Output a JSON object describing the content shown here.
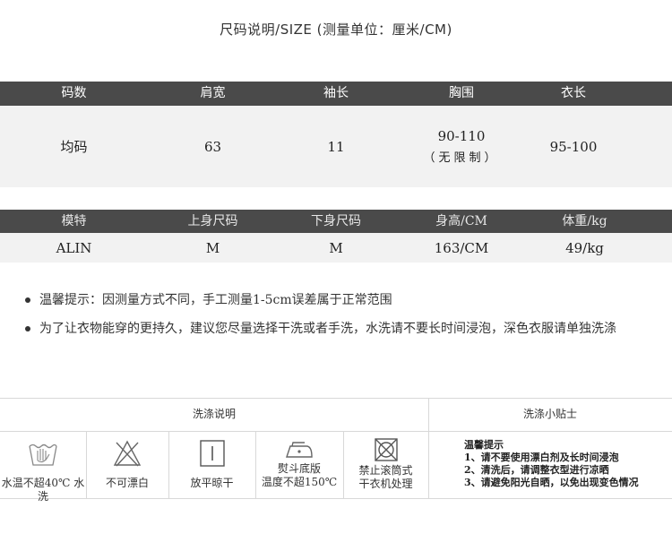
{
  "title": "尺码说明/SIZE (测量单位：厘米/CM)",
  "size_table": {
    "headers": [
      "码数",
      "肩宽",
      "袖长",
      "胸围",
      "衣长"
    ],
    "row": {
      "size": "均码",
      "shoulder": "63",
      "sleeve": "11",
      "chest": "90-110",
      "chest_note": "（无限制）",
      "length": "95-100"
    }
  },
  "model_table": {
    "headers": [
      "模特",
      "上身尺码",
      "下身尺码",
      "身高/CM",
      "体重/kg"
    ],
    "row": [
      "ALIN",
      "M",
      "M",
      "163/CM",
      "49/kg"
    ]
  },
  "notes": [
    "温馨提示：因测量方式不同，手工测量1-5cm误差属于正常范围",
    "为了让衣物能穿的更持久，建议您尽量选择干洗或者手洗，水洗请不要长时间浸泡，深色衣服请单独洗涤"
  ],
  "wash": {
    "instructions_title": "洗涤说明",
    "tips_title": "洗涤小贴士",
    "items": [
      {
        "icon": "hand-wash-icon",
        "label": "水温不超40℃ 水洗"
      },
      {
        "icon": "no-bleach-icon",
        "label": "不可漂白"
      },
      {
        "icon": "flat-dry-icon",
        "label": "放平晾干"
      },
      {
        "icon": "iron-low-icon",
        "label_1": "熨斗底版",
        "label_2": "温度不超150℃"
      },
      {
        "icon": "no-tumble-dry-icon",
        "label_1": "禁止滚筒式",
        "label_2": "干衣机处理"
      }
    ],
    "tips": [
      "温馨提示",
      "1、请不要使用漂白剂及长时间浸泡",
      "2、清洗后，请调整衣型进行凉晒",
      "3、请避免阳光自晒，以免出现变色情况"
    ]
  }
}
